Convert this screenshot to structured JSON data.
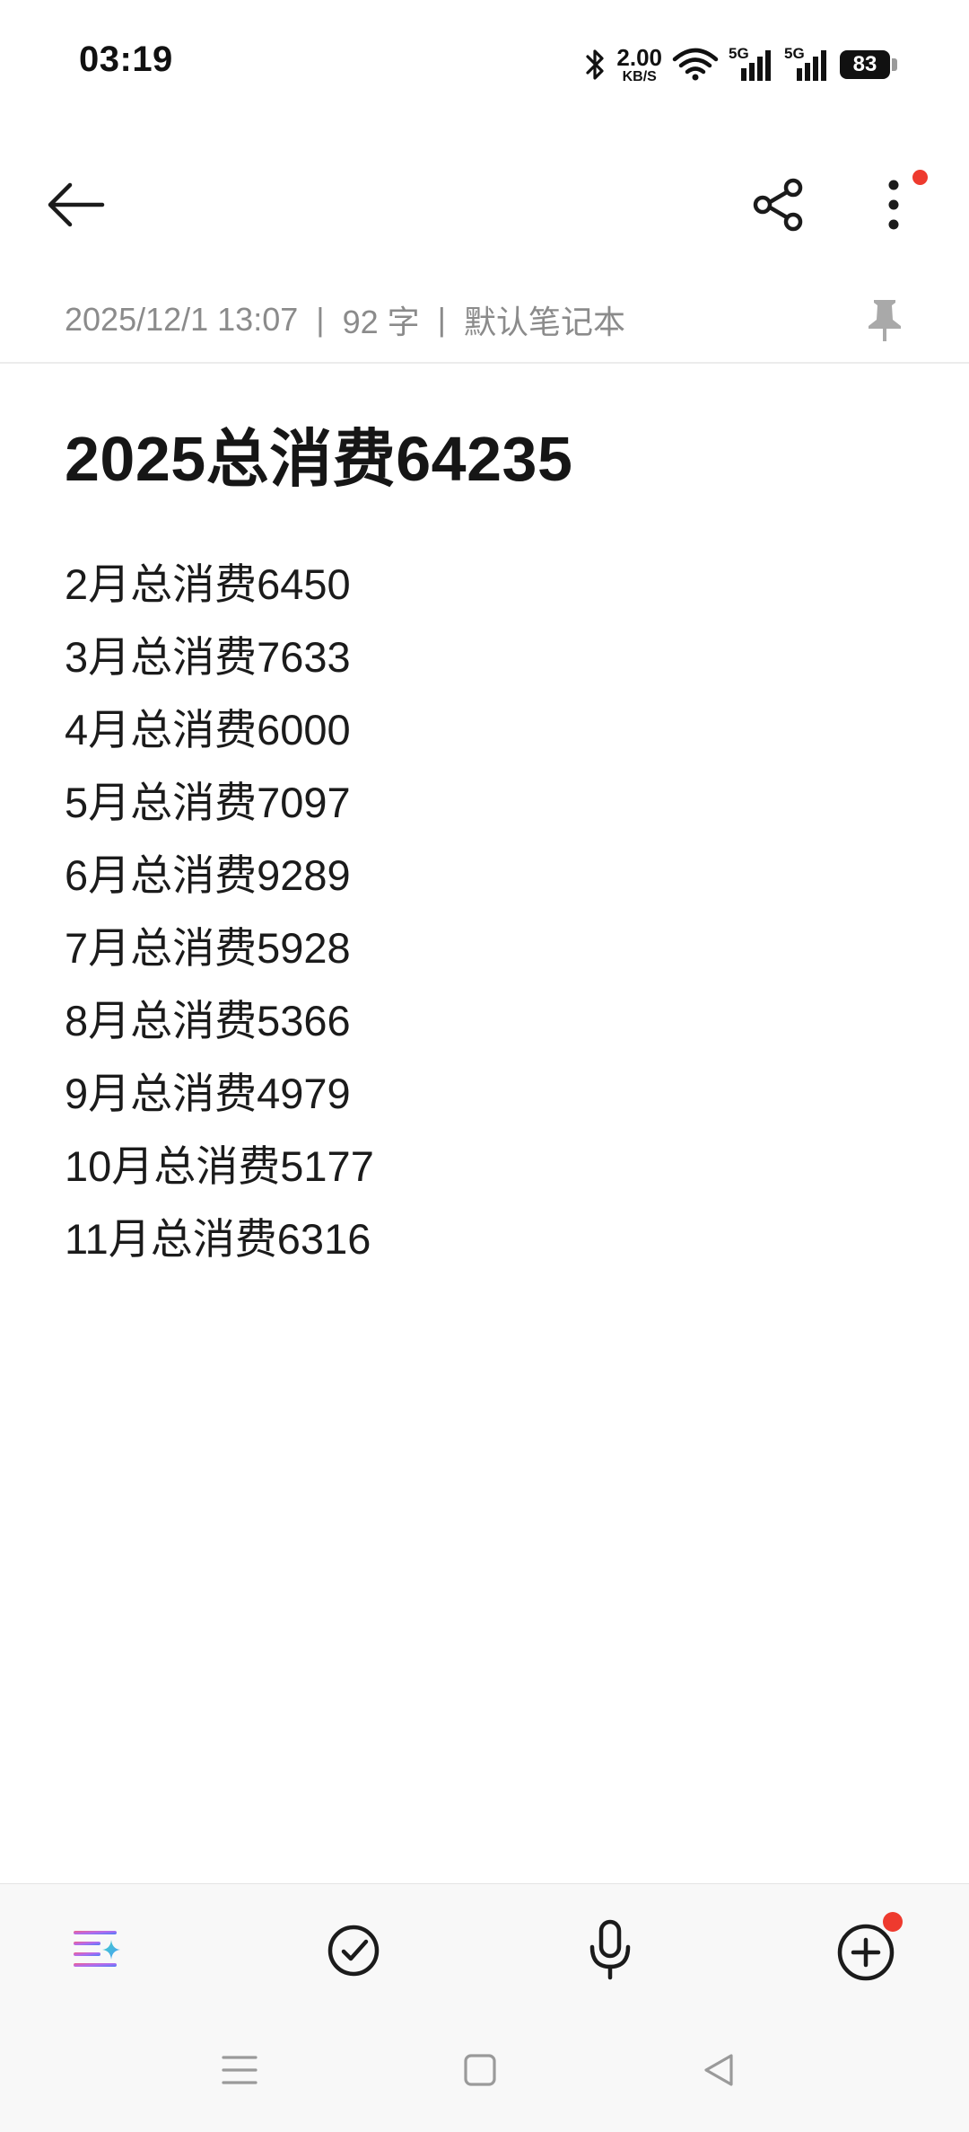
{
  "status_bar": {
    "time": "03:19",
    "net_speed_value": "2.00",
    "net_speed_unit": "KB/S",
    "signal1_label": "5G",
    "signal2_label": "5G",
    "battery": "83",
    "icons": [
      "bluetooth-icon",
      "wifi-icon",
      "signal-icon",
      "signal-icon",
      "battery-icon"
    ]
  },
  "app_bar": {
    "icons": [
      "back-arrow-icon",
      "share-icon",
      "more-vertical-icon"
    ]
  },
  "meta": {
    "datetime": "2025/12/1 13:07",
    "separator": "|",
    "word_count": "92 字",
    "notebook": "默认笔记本"
  },
  "note": {
    "title": "2025总消费64235",
    "lines": [
      "2月总消费6450",
      "3月总消费7633",
      "4月总消费6000",
      "5月总消费7097",
      "6月总消费9289",
      "7月总消费5928",
      "8月总消费5366",
      "9月总消费4979",
      "10月总消费5177",
      "11月总消费6316"
    ]
  },
  "toolbar": {
    "icons": [
      "format-ai-icon",
      "checklist-icon",
      "microphone-icon",
      "add-circle-icon"
    ]
  },
  "colors": {
    "badge": "#ee3a2e",
    "text_primary": "#1b1b1b",
    "text_secondary": "#8b8b8b"
  }
}
